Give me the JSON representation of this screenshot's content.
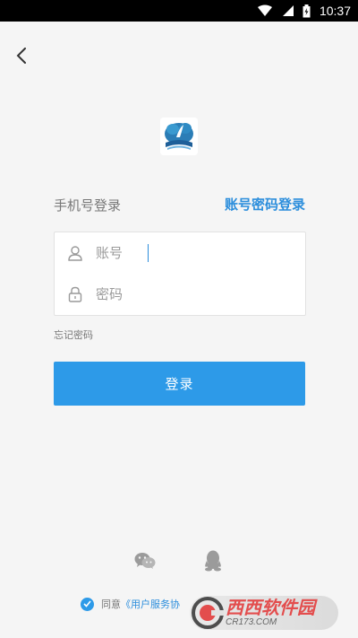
{
  "status_bar": {
    "time": "10:37",
    "icons": [
      "wifi-icon",
      "signal-icon",
      "battery-icon"
    ]
  },
  "header": {
    "back_icon": "chevron-left-icon"
  },
  "login": {
    "tab_phone": "手机号登录",
    "tab_account": "账号密码登录",
    "account_placeholder": "账号",
    "password_placeholder": "密码",
    "forgot_password": "忘记密码",
    "login_button": "登录"
  },
  "social": {
    "items": [
      "wechat-icon",
      "qq-icon"
    ]
  },
  "agreement": {
    "prefix": "同意",
    "link_text": "《用户服务协"
  },
  "watermark": {
    "title": "西西软件园",
    "subtitle": "CR173.COM"
  },
  "colors": {
    "accent": "#2d9ae8",
    "link": "#2c8edc",
    "background": "#f5f5f5",
    "statusbar": "#000000"
  }
}
